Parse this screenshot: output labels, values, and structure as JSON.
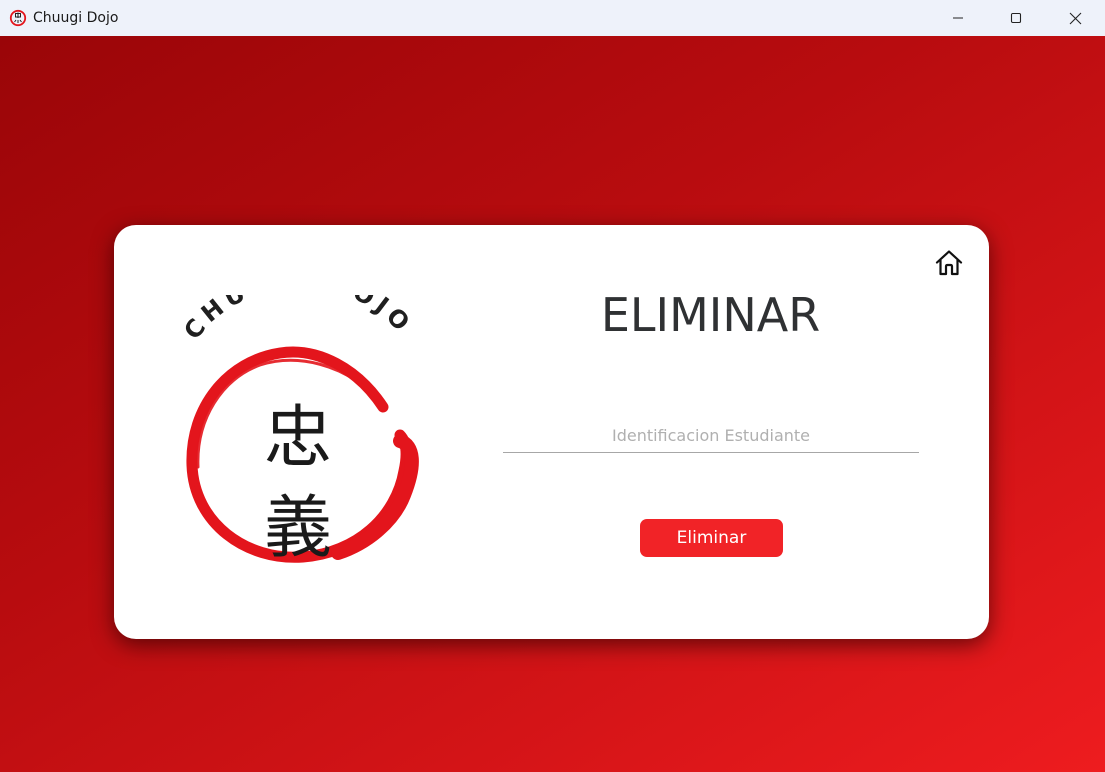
{
  "window": {
    "title": "Chuugi Dojo",
    "icons": {
      "app": "dojo-logo-icon",
      "minimize": "minimize-icon",
      "maximize": "maximize-icon",
      "close": "close-icon"
    }
  },
  "logo": {
    "text": "CHUUGI DOJO",
    "kanji_top": "忠",
    "kanji_bottom": "義"
  },
  "form": {
    "heading": "ELIMINAR",
    "id_placeholder": "Identificacion Estudiante",
    "id_value": "",
    "submit_label": "Eliminar",
    "home_icon": "home-icon"
  },
  "colors": {
    "accent": "#f12327",
    "background_dark": "#9a0508",
    "background_light": "#ee1c1f",
    "logo_red": "#e3151c",
    "text_dark": "#2f3133"
  }
}
